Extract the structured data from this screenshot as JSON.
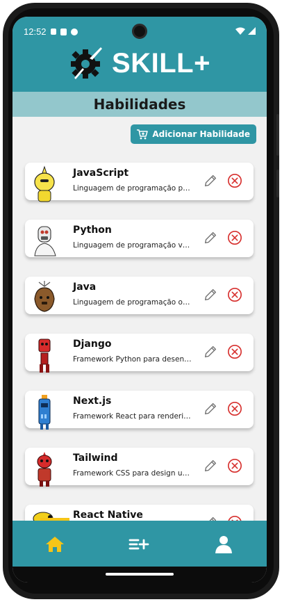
{
  "status_bar": {
    "time": "12:52"
  },
  "header": {
    "brand": "SKILL+",
    "page_title": "Habilidades"
  },
  "toolbar": {
    "add_label": "Adicionar Habilidade"
  },
  "skills": [
    {
      "name": "JavaScript",
      "description": "Linguagem de programação para web dinâmica"
    },
    {
      "name": "Python",
      "description": "Linguagem de programação versátil e poderosa"
    },
    {
      "name": "Java",
      "description": "Linguagem de programação orientada a objetos"
    },
    {
      "name": "Django",
      "description": "Framework Python para desenvolvimento web"
    },
    {
      "name": "Next.js",
      "description": "Framework React para renderização no servidor"
    },
    {
      "name": "Tailwind",
      "description": "Framework CSS para design utilitário"
    },
    {
      "name": "React Native",
      "description": ""
    }
  ],
  "bottom_nav": {
    "items": [
      "home-icon",
      "add-list-icon",
      "user-icon"
    ]
  },
  "colors": {
    "primary": "#2f96a4",
    "title_bar": "#93c7cc",
    "active": "#f5c518",
    "delete": "#d7312f"
  }
}
